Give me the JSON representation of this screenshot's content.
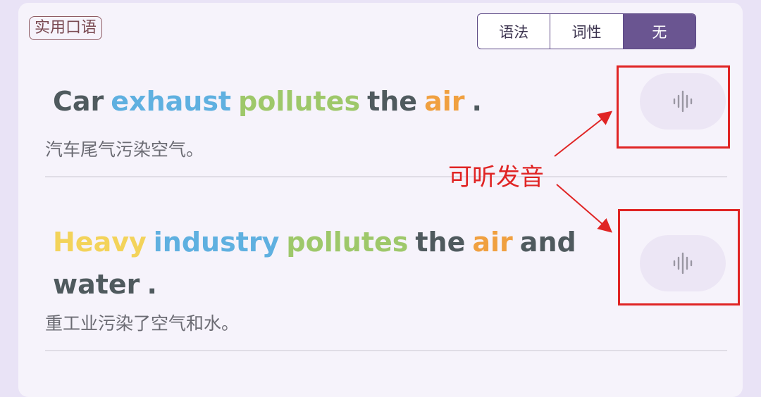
{
  "tag": {
    "label": "实用口语"
  },
  "segmented": {
    "options": [
      "语法",
      "词性",
      "无"
    ],
    "selected": "无"
  },
  "sentences": [
    {
      "words": [
        {
          "text": "Car",
          "color": "#4f5a5e"
        },
        {
          "text": "exhaust",
          "color": "#5fb0e0"
        },
        {
          "text": "pollutes",
          "color": "#9ec86a"
        },
        {
          "text": "the",
          "color": "#4f5a5e"
        },
        {
          "text": "air",
          "color": "#f0a040"
        },
        {
          "text": ".",
          "color": "#4f5a5e"
        }
      ],
      "translation": "汽车尾气污染空气。",
      "audio_icon": "sound-wave-icon"
    },
    {
      "words": [
        {
          "text": "Heavy",
          "color": "#f3d35a"
        },
        {
          "text": "industry",
          "color": "#5fb0e0"
        },
        {
          "text": "pollutes",
          "color": "#9ec86a"
        },
        {
          "text": "the",
          "color": "#4f5a5e"
        },
        {
          "text": "air",
          "color": "#f0a040"
        },
        {
          "text": "and",
          "color": "#4f5a5e"
        },
        {
          "text": "water",
          "color": "#4f5a5e"
        },
        {
          "text": ".",
          "color": "#4f5a5e"
        }
      ],
      "translation": "重工业污染了空气和水。",
      "audio_icon": "sound-wave-icon"
    }
  ],
  "annotation": {
    "label": "可听发音",
    "color": "#e02424"
  }
}
